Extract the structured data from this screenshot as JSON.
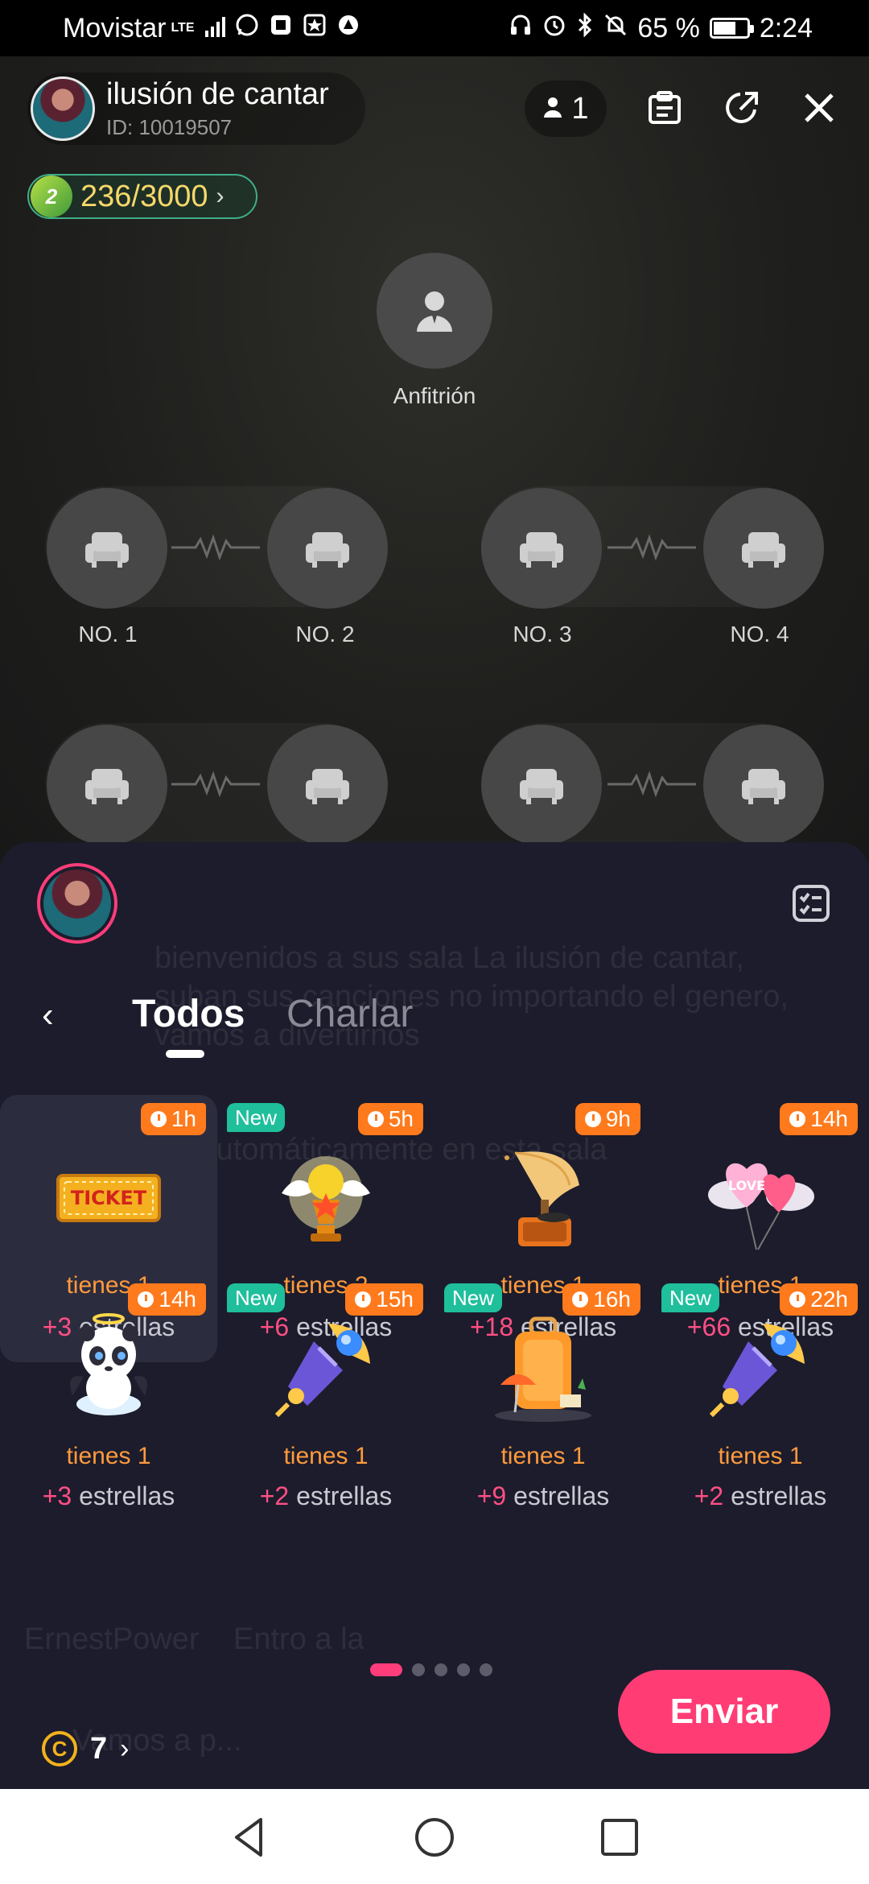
{
  "status_bar": {
    "carrier": "Movistar",
    "network": "LTE",
    "battery_percent": "65 %",
    "battery_level": 65,
    "time": "2:24"
  },
  "room": {
    "name": "ilusión de cantar",
    "id": "ID: 10019507",
    "user_count": "1",
    "level_progress": "236/3000",
    "level_badge": "2",
    "host_label": "Anfitrión",
    "seats": [
      "NO. 1",
      "NO. 2",
      "NO. 3",
      "NO. 4"
    ],
    "background_chat": {
      "welcome": "bienvenidos a sus sala La ilusión de cantar, suban sus canciones no importando el genero, vamos a divertirnos",
      "notice": "...sentado automáticamente en esta sala",
      "join_user": "ErnestPower",
      "join_text": "Entro a la",
      "input_hint": "Vamos a p..."
    }
  },
  "gift_panel": {
    "tabs": [
      {
        "label": "Todos",
        "active": true
      },
      {
        "label": "Charlar",
        "active": false
      }
    ],
    "gifts": [
      {
        "icon": "ticket-icon",
        "timer": "1h",
        "is_new": false,
        "owned": "tienes 1",
        "stars_plus": "+3",
        "stars_label": "estrellas",
        "selected": true
      },
      {
        "icon": "winged-trophy-icon",
        "timer": "5h",
        "is_new": true,
        "owned": "tienes 2",
        "stars_plus": "+6",
        "stars_label": "estrellas",
        "selected": false
      },
      {
        "icon": "gramophone-icon",
        "timer": "9h",
        "is_new": false,
        "owned": "tienes 1",
        "stars_plus": "+18",
        "stars_label": "estrellas",
        "selected": false
      },
      {
        "icon": "love-balloons-icon",
        "timer": "14h",
        "is_new": false,
        "owned": "tienes 1",
        "stars_plus": "+66",
        "stars_label": "estrellas",
        "selected": false
      },
      {
        "icon": "angel-panda-icon",
        "timer": "14h",
        "is_new": false,
        "owned": "tienes 1",
        "stars_plus": "+3",
        "stars_label": "estrellas",
        "selected": false
      },
      {
        "icon": "gem-scepter-icon",
        "timer": "15h",
        "is_new": true,
        "owned": "tienes 1",
        "stars_plus": "+2",
        "stars_label": "estrellas",
        "selected": false
      },
      {
        "icon": "suitcase-icon",
        "timer": "16h",
        "is_new": true,
        "owned": "tienes 1",
        "stars_plus": "+9",
        "stars_label": "estrellas",
        "selected": false
      },
      {
        "icon": "gem-scepter-icon",
        "timer": "22h",
        "is_new": true,
        "owned": "tienes 1",
        "stars_plus": "+2",
        "stars_label": "estrellas",
        "selected": false
      }
    ],
    "new_label": "New",
    "page_count": 5,
    "active_page": 1,
    "coin_balance": "7",
    "send_label": "Enviar"
  },
  "colors": {
    "accent": "#ff3d74",
    "timer_badge": "#ff7a1c",
    "new_badge": "#1fbf9c",
    "owned_text": "#ff9a3d",
    "panel_bg": "#1c1c2c"
  }
}
